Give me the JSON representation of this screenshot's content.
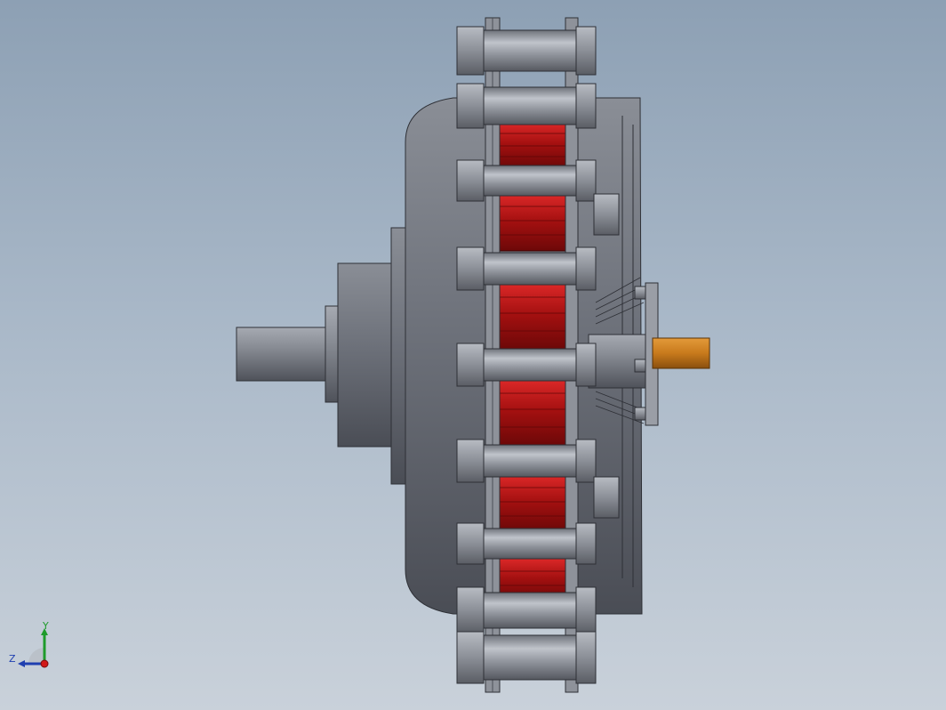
{
  "viewport": {
    "background_top": "#8da0b4",
    "background_bottom": "#c9d1da"
  },
  "model": {
    "body_color": "#7b7f88",
    "magnet_color": "#b01414",
    "shaft_tip_color": "#c87a1c",
    "bolt_color": "#9aa0a8"
  },
  "triad": {
    "y_label": "Y",
    "z_label": "Z",
    "y_color": "#1e9b2b",
    "z_color": "#1f3fb0",
    "x_color": "#d21818"
  }
}
